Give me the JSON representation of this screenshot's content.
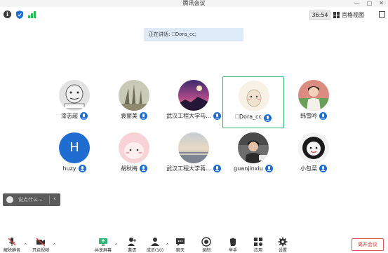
{
  "window": {
    "title": "腾讯会议",
    "controls": [
      "—",
      "□",
      "✕"
    ]
  },
  "status": {
    "timer": "36:54",
    "view_label": "宫格视图"
  },
  "banner": {
    "text": "正在讲话: 🗆Dora_cc;"
  },
  "participants": [
    {
      "name": "漆志超",
      "avatar_bg": "#d9d9d9",
      "muted": false
    },
    {
      "name": "袁丽美",
      "avatar_bg": "#8d8f79",
      "muted": false
    },
    {
      "name": "武汉工程大学马...",
      "avatar_bg": "#5b3f8c",
      "muted": false
    },
    {
      "name": "🗆Dora_cc",
      "avatar_bg": "#f6ede2",
      "muted": false,
      "active": true
    },
    {
      "name": "韩雪吟",
      "avatar_bg": "#cc7d72",
      "muted": false
    },
    {
      "name": "huzy",
      "avatar_bg": "#1f6dd1",
      "initial": "H",
      "muted": false
    },
    {
      "name": "胡秋梅",
      "avatar_bg": "#f6c8cf",
      "muted": false
    },
    {
      "name": "武汉工程大学蒋...",
      "avatar_bg": "#9aa1a8",
      "muted": false
    },
    {
      "name": "guanjinxiu",
      "avatar_bg": "#5a5a5a",
      "muted": false
    },
    {
      "name": "小包菜",
      "avatar_bg": "#1b1b1b",
      "muted": false
    }
  ],
  "chat": {
    "placeholder": "说点什么...",
    "collapse": "‹"
  },
  "toolbar": {
    "mute": "解除静音",
    "video": "开启视频",
    "share": "共享屏幕",
    "invite": "邀请",
    "members": "成员(10)",
    "chat": "聊天",
    "record": "录制",
    "raise": "举手",
    "apps": "应用",
    "settings": "设置",
    "leave": "离开会议"
  },
  "colors": {
    "accent": "#1f6dd1",
    "active_border": "#2bb673",
    "leave": "#d83b3b"
  }
}
